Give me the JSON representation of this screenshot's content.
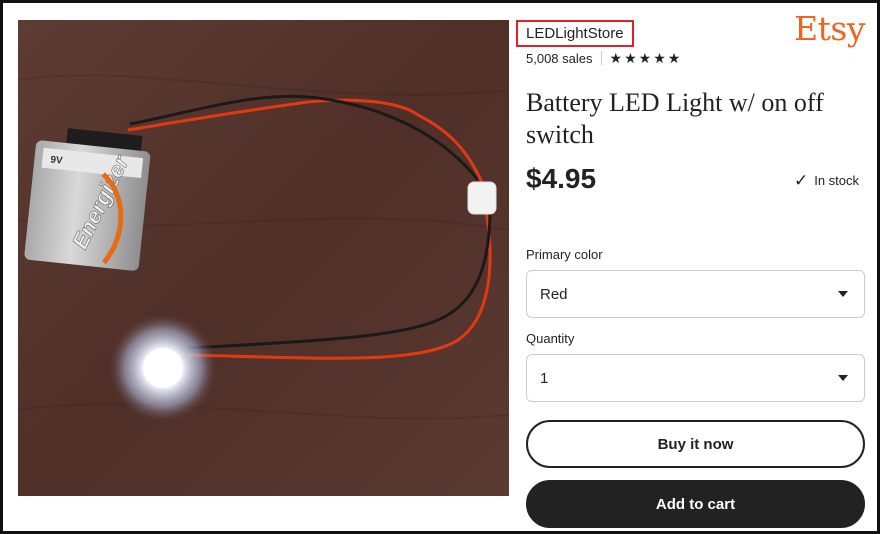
{
  "brand": "Etsy",
  "shop": {
    "name": "LEDLightStore",
    "sales": "5,008 sales",
    "rating_stars": 5
  },
  "product": {
    "title": "Battery LED Light w/ on off switch",
    "price": "$4.95",
    "stock_status": "In stock",
    "image": {
      "battery_brand": "Energizer",
      "battery_voltage": "9V"
    }
  },
  "options": {
    "color_label": "Primary color",
    "color_value": "Red",
    "quantity_label": "Quantity",
    "quantity_value": "1"
  },
  "actions": {
    "buy_now": "Buy it now",
    "add_to_cart": "Add to cart"
  },
  "colors": {
    "brand": "#f1641e",
    "highlight_border": "#e0202a",
    "button_dark": "#222222"
  }
}
